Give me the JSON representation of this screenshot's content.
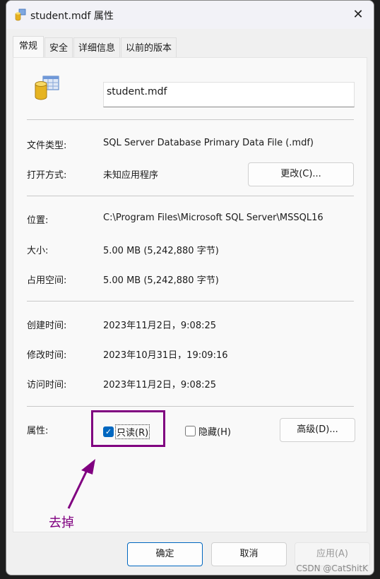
{
  "window": {
    "title": "student.mdf 属性",
    "close_icon": "close-icon"
  },
  "tabs": [
    {
      "label": "常规",
      "active": true
    },
    {
      "label": "安全"
    },
    {
      "label": "详细信息"
    },
    {
      "label": "以前的版本"
    }
  ],
  "general": {
    "file_name": "student.mdf",
    "file_type_label": "文件类型:",
    "file_type": "SQL Server Database Primary Data File (.mdf)",
    "open_with_label": "打开方式:",
    "open_with": "未知应用程序",
    "change_button": "更改(C)...",
    "location_label": "位置:",
    "location": "C:\\Program Files\\Microsoft SQL Server\\MSSQL16",
    "size_label": "大小:",
    "size": "5.00 MB (5,242,880 字节)",
    "size_on_disk_label": "占用空间:",
    "size_on_disk": "5.00 MB (5,242,880 字节)",
    "created_label": "创建时间:",
    "created": "2023年11月2日，9:08:25",
    "modified_label": "修改时间:",
    "modified": "2023年10月31日，19:09:16",
    "accessed_label": "访问时间:",
    "accessed": "2023年11月2日，9:08:25",
    "attributes_label": "属性:",
    "readonly_label": "只读(R)",
    "readonly_checked": true,
    "hidden_label": "隐藏(H)",
    "hidden_checked": false,
    "advanced_button": "高级(D)..."
  },
  "annotation": {
    "text": "去掉",
    "color": "#800080"
  },
  "footer": {
    "ok": "确定",
    "cancel": "取消",
    "apply": "应用(A)"
  },
  "watermark": "CSDN @CatShitK",
  "colors": {
    "accent": "#0067c0",
    "annotation": "#800080"
  }
}
